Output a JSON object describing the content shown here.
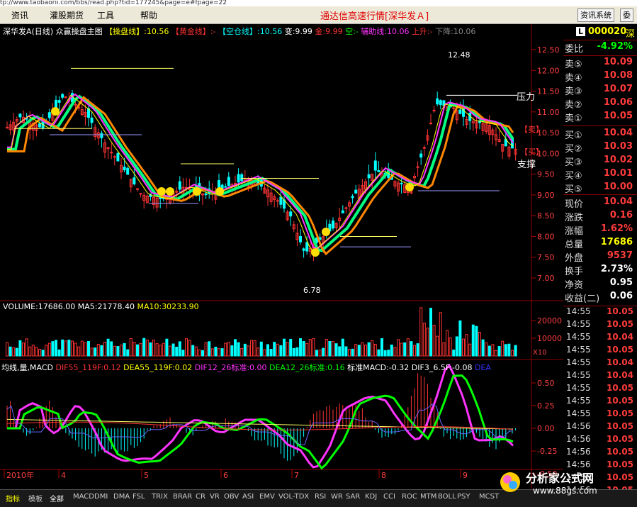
{
  "url": "tp://www.taobaorii.com/bbs/read.php?tid=177245&page=e#fpage=22",
  "menu": {
    "items": [
      "资讯",
      "灌股期货",
      "工具",
      "帮助"
    ],
    "app_title": "通达信高速行情[深华发Ａ]",
    "btn_info": "资讯系统",
    "btn_clip": "委"
  },
  "header": {
    "name": "深华发A",
    "period": "(日线)",
    "indicator": "众赢操盘主图",
    "ind_values": [
      {
        "label": "【操盘线】:10.56",
        "color": "#ffff00"
      },
      {
        "label": "【黄金线】:-",
        "color": "#ff3333"
      },
      {
        "label": "【空仓线】:10.56",
        "color": "#00ffff"
      },
      {
        "label": "变:9.99",
        "color": "#ffffff"
      },
      {
        "label": "金:9.99",
        "color": "#ff3333"
      },
      {
        "label": "空:-",
        "color": "#00ff00"
      },
      {
        "label": "辅助线:10.06",
        "color": "#ff33ff"
      },
      {
        "label": "上升:-",
        "color": "#ff3333"
      },
      {
        "label": "下降:10.06",
        "color": "#888888"
      }
    ]
  },
  "price_chart": {
    "y_ticks": [
      "12.50",
      "12.00",
      "11.50",
      "11.00",
      "10.50",
      "10.00",
      "9.50",
      "9.00",
      "8.50",
      "8.00",
      "7.50",
      "7.00"
    ],
    "annotations": {
      "high": "12.48",
      "low": "6.78",
      "pressure": "压力",
      "support": "支撑"
    },
    "side_marks": [
      "【卖】",
      "【买】"
    ]
  },
  "volume_chart": {
    "header": [
      {
        "label": "VOLUME:17686.00",
        "color": "#ffffff"
      },
      {
        "label": "MA5:21778.40",
        "color": "#ffffff"
      },
      {
        "label": "MA10:30233.90",
        "color": "#ffff00"
      }
    ],
    "y_ticks": [
      "20000",
      "10000"
    ],
    "unit": "X10"
  },
  "macd_chart": {
    "header": [
      {
        "label": "均线,量,MACD",
        "color": "#ffffff"
      },
      {
        "label": "DIF55_119F:0.12",
        "color": "#ff3333"
      },
      {
        "label": "DEA55_119F:0.02",
        "color": "#ffff00"
      },
      {
        "label": "DIF12_26标准:0.00",
        "color": "#ff33ff"
      },
      {
        "label": "DEA12_26标准:0.16",
        "color": "#00ff00"
      },
      {
        "label": "标准MACD:-0.32",
        "color": "#ffffff"
      },
      {
        "label": "DIF3_6.5F:-0.08",
        "color": "#ffffff"
      },
      {
        "label": "DEA",
        "color": "#3333ff"
      }
    ],
    "y_ticks": [
      "0.50",
      "0.25",
      "0.00",
      "-0.25",
      "-0.50"
    ]
  },
  "x_axis": {
    "labels": [
      "2010年",
      "4",
      "5",
      "6",
      "7",
      "8",
      "9"
    ]
  },
  "quote": {
    "code": "000020",
    "code_suffix": "深",
    "l_badge": "L",
    "webi": {
      "label": "委比",
      "value": "-4.92%"
    },
    "asks": [
      {
        "label": "卖⑤",
        "price": "10.09"
      },
      {
        "label": "卖④",
        "price": "10.08"
      },
      {
        "label": "卖③",
        "price": "10.07"
      },
      {
        "label": "卖②",
        "price": "10.06"
      },
      {
        "label": "卖①",
        "price": "10.05"
      }
    ],
    "bids": [
      {
        "label": "买①",
        "price": "10.04"
      },
      {
        "label": "买②",
        "price": "10.03"
      },
      {
        "label": "买③",
        "price": "10.02"
      },
      {
        "label": "买④",
        "price": "10.01"
      },
      {
        "label": "买⑤",
        "price": "10.00"
      }
    ],
    "stats": [
      {
        "label": "现价",
        "value": "10.04",
        "color": "#ff3b3b"
      },
      {
        "label": "涨跌",
        "value": "0.16",
        "color": "#ff3b3b"
      },
      {
        "label": "涨幅",
        "value": "1.62%",
        "color": "#ff3b3b"
      },
      {
        "label": "总量",
        "value": "17686",
        "color": "#ffff00"
      },
      {
        "label": "外盘",
        "value": "9537",
        "color": "#ff3b3b"
      },
      {
        "label": "换手",
        "value": "2.73%",
        "color": "#ffffff"
      },
      {
        "label": "净资",
        "value": "0.95",
        "color": "#ffffff"
      },
      {
        "label": "收益(二)",
        "value": "0.06",
        "color": "#ffffff"
      }
    ]
  },
  "ticks": [
    {
      "time": "14:55",
      "price": "10.05"
    },
    {
      "time": "14:55",
      "price": "10.05"
    },
    {
      "time": "14:55",
      "price": "10.04"
    },
    {
      "time": "14:55",
      "price": "10.05"
    },
    {
      "time": "14:55",
      "price": "10.04"
    },
    {
      "time": "14:55",
      "price": "10.04"
    },
    {
      "time": "14:55",
      "price": "10.05"
    },
    {
      "time": "14:55",
      "price": "10.05"
    },
    {
      "time": "14:55",
      "price": "10.05"
    },
    {
      "time": "14:56",
      "price": "10.05"
    },
    {
      "time": "14:56",
      "price": "10.05"
    },
    {
      "time": "14:56",
      "price": "10.05"
    },
    {
      "time": "14:56",
      "price": "10.05"
    },
    {
      "time": "14:56",
      "price": "10.05"
    },
    {
      "time": "14:56",
      "price": "10.05"
    }
  ],
  "tabs": [
    "指标",
    "模板",
    "全部",
    "MACD",
    "DMI",
    "DMA",
    "FSL",
    "TRIX",
    "BRAR",
    "CR",
    "VR",
    "OBV",
    "ASI",
    "EMV",
    "VOL-TDX",
    "RSI",
    "WR",
    "SAR",
    "KDJ",
    "CCI",
    "ROC",
    "MTM",
    "BOLL",
    "PSY",
    "MCST"
  ],
  "watermark": {
    "title": "分析家公式网",
    "url": "www.88gs.com"
  }
}
